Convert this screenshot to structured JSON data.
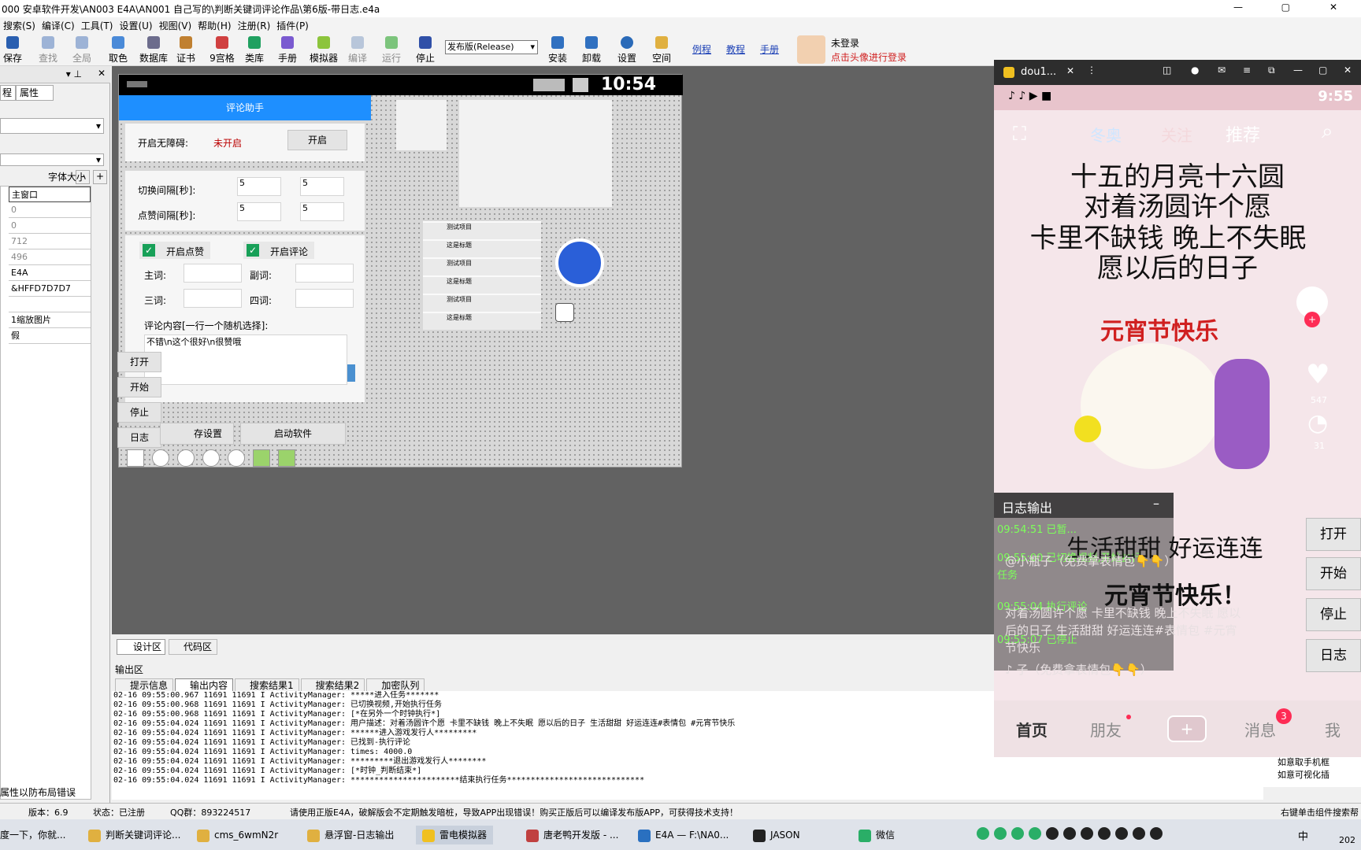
{
  "window_title": "000 安卓软件开发\\AN003 E4A\\AN001 自己写的\\判断关键词评论作品\\第6版-带日志.e4a",
  "menu": [
    "搜索(S)",
    "编译(C)",
    "工具(T)",
    "设置(U)",
    "视图(V)",
    "帮助(H)",
    "注册(R)",
    "插件(P)"
  ],
  "toolbar": {
    "buttons": [
      "保存",
      "查找",
      "全局",
      "取色",
      "数据库",
      "证书",
      "9宫格",
      "类库",
      "手册",
      "模拟器",
      "编译",
      "运行",
      "停止"
    ],
    "build_mode": "发布版(Release)",
    "buttons2": [
      "安装",
      "卸载",
      "设置",
      "空间"
    ],
    "links": [
      "例程",
      "教程",
      "手册"
    ],
    "login_status": "未登录",
    "login_hint": "点击头像进行登录"
  },
  "left_panel": {
    "tabs": [
      "程",
      "属性"
    ],
    "font_size_label": "字体大小",
    "properties": [
      "主窗口",
      "0",
      "0",
      "712",
      "496",
      "E4A",
      "&HFFD7D7D7",
      "",
      "1缩放图片",
      "假"
    ],
    "footer": "属性以防布局错误"
  },
  "designer": {
    "phone_time": "10:54",
    "app_title": "评论助手",
    "accessibility_label": "开启无障碍:",
    "accessibility_status": "未开启",
    "accessibility_button": "开启",
    "switch_interval_label": "切换间隔[秒]:",
    "like_interval_label": "点赞间隔[秒]:",
    "interval_values": [
      "5",
      "5",
      "5",
      "5"
    ],
    "enable_like": "开启点赞",
    "enable_comment": "开启评论",
    "word_labels": [
      "主词:",
      "副词:",
      "三词:",
      "四词:"
    ],
    "comment_content_label": "评论内容[一行一个随机选择]:",
    "comment_content_value": "不错\\n这个很好\\n很赞哦",
    "side_buttons": [
      "打开",
      "开始",
      "停止",
      "日志"
    ],
    "save_settings_button": "存设置",
    "launch_button": "启动软件",
    "list_items": [
      "测试项目",
      "这是标题",
      "测试项目",
      "这是标题",
      "测试项目",
      "这是标题"
    ]
  },
  "view_tabs": [
    "设计区",
    "代码区"
  ],
  "output": {
    "title": "输出区",
    "tabs": [
      "提示信息",
      "输出内容",
      "搜索结果1",
      "搜索结果2",
      "加密队列"
    ],
    "lines": [
      "02-16 09:55:00.967 11691 11691 I ActivityManager: *****进入任务*******",
      "02-16 09:55:00.968 11691 11691 I ActivityManager: 已切换视频,开始执行任务",
      "02-16 09:55:00.968 11691 11691 I ActivityManager: [*在另外一个时钟执行*]",
      "02-16 09:55:04.024 11691 11691 I ActivityManager: 用户描述：对着汤圆许个愿 卡里不缺钱 晚上不失眠 愿以后的日子 生活甜甜 好运连连#表情包 #元宵节快乐",
      "02-16 09:55:04.024 11691 11691 I ActivityManager: ******进入游戏发行人*********",
      "02-16 09:55:04.024 11691 11691 I ActivityManager: 已找到-执行评论",
      "02-16 09:55:04.024 11691 11691 I ActivityManager: times: 4000.0",
      "02-16 09:55:04.024 11691 11691 I ActivityManager: *********退出游戏发行人********",
      "02-16 09:55:04.024 11691 11691 I ActivityManager: [*时钟_判断结束*]",
      "02-16 09:55:04.024 11691 11691 I ActivityManager: ***********************结束执行任务*****************************"
    ]
  },
  "statusbar": {
    "version": "版本：6.9",
    "state": "状态：已注册",
    "qq": "QQ群：893224517",
    "notice": "请使用正版E4A，破解版会不定期触发暗桩，导致APP出现错误！购买正版后可以编译发布版APP，可获得技术支持！",
    "right_hint": "右键单击组件搜索帮"
  },
  "right_strip": [
    "如意取手机框",
    "如意可视化插"
  ],
  "phone2": {
    "tab_title": "dou1...",
    "time": "9:55",
    "tabs": [
      "冬奥",
      "关注",
      "推荐"
    ],
    "lines": [
      "十五的月亮十六圆",
      "对着汤圆许个愿",
      "卡里不缺钱 晚上不失眠",
      "愿以后的日子"
    ],
    "sticker_title": "元宵节快乐",
    "likes": "547",
    "comments": "31",
    "log_title": "日志输出",
    "log_lines": [
      "09:54:51 已暂...",
      "09:55:00 已切换视频,开始执行",
      "任务",
      "09:55:04 执行评论",
      "09:55:07 已停止"
    ],
    "caption1": "生活甜甜   好运连连",
    "caption2": "元宵节快乐！",
    "author": "@小瓶子（免费拿表情包👇👇）",
    "description": "对着汤圆许个愿 卡里不缺钱 晚上不失眠 愿以后的日子 生活甜甜 好运连连#表情包 #元宵节快乐",
    "music": "子（免费拿表情包👇👇）",
    "side_buttons": [
      "打开",
      "开始",
      "停止",
      "日志"
    ],
    "nav": [
      "首页",
      "朋友",
      "+",
      "消息",
      "我"
    ],
    "msg_badge": "3"
  },
  "taskbar": [
    "度一下，你就...",
    "判断关键词评论...",
    "cms_6wmN2r",
    "悬浮窗-日志输出",
    "雷电模拟器",
    "唐老鸭开发版 - ...",
    "E4A — F:\\NA0...",
    "JASON",
    "微信"
  ],
  "tray": {
    "lang": "中",
    "year": "202"
  }
}
